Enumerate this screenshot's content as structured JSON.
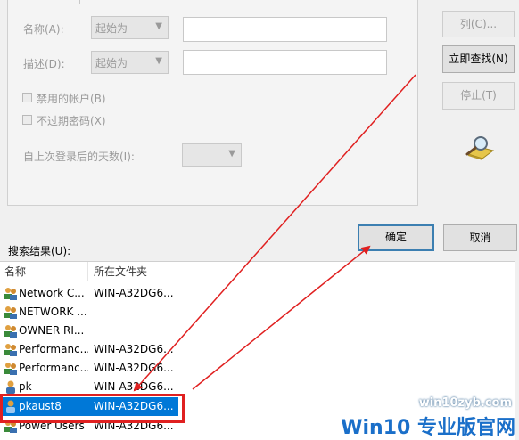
{
  "form": {
    "name_label": "名称(A):",
    "name_mode": "起始为",
    "desc_label": "描述(D):",
    "desc_mode": "起始为",
    "disabled_accounts": "禁用的帐户(B)",
    "non_expiring_pwd": "不过期密码(X)",
    "days_since_logon": "自上次登录后的天数(I):"
  },
  "side_buttons": {
    "columns": "列(C)...",
    "find_now": "立即查找(N)",
    "stop": "停止(T)"
  },
  "dialog_buttons": {
    "ok": "确定",
    "cancel": "取消"
  },
  "results": {
    "label": "搜索结果(U):",
    "columns": [
      "名称",
      "所在文件夹"
    ],
    "rows": [
      {
        "name": "Network C...",
        "folder": "WIN-A32DG6...",
        "icon": "group-icon"
      },
      {
        "name": "NETWORK ...",
        "folder": "",
        "icon": "group-icon"
      },
      {
        "name": "OWNER RI...",
        "folder": "",
        "icon": "group-icon"
      },
      {
        "name": "Performanc...",
        "folder": "WIN-A32DG6...",
        "icon": "group-icon"
      },
      {
        "name": "Performanc...",
        "folder": "WIN-A32DG6...",
        "icon": "group-icon"
      },
      {
        "name": "pk",
        "folder": "WIN-A32DG6...",
        "icon": "user-icon"
      },
      {
        "name": "pkaust8",
        "folder": "WIN-A32DG6...",
        "icon": "user-icon",
        "selected": true
      },
      {
        "name": "Power Users",
        "folder": "WIN-A32DG6...",
        "icon": "group-icon"
      }
    ]
  },
  "watermark": {
    "site": "win10zyb.com",
    "brand": "Win10 专业版官网"
  },
  "colors": {
    "selection": "#0078d7",
    "annotation_red": "#e02020"
  }
}
